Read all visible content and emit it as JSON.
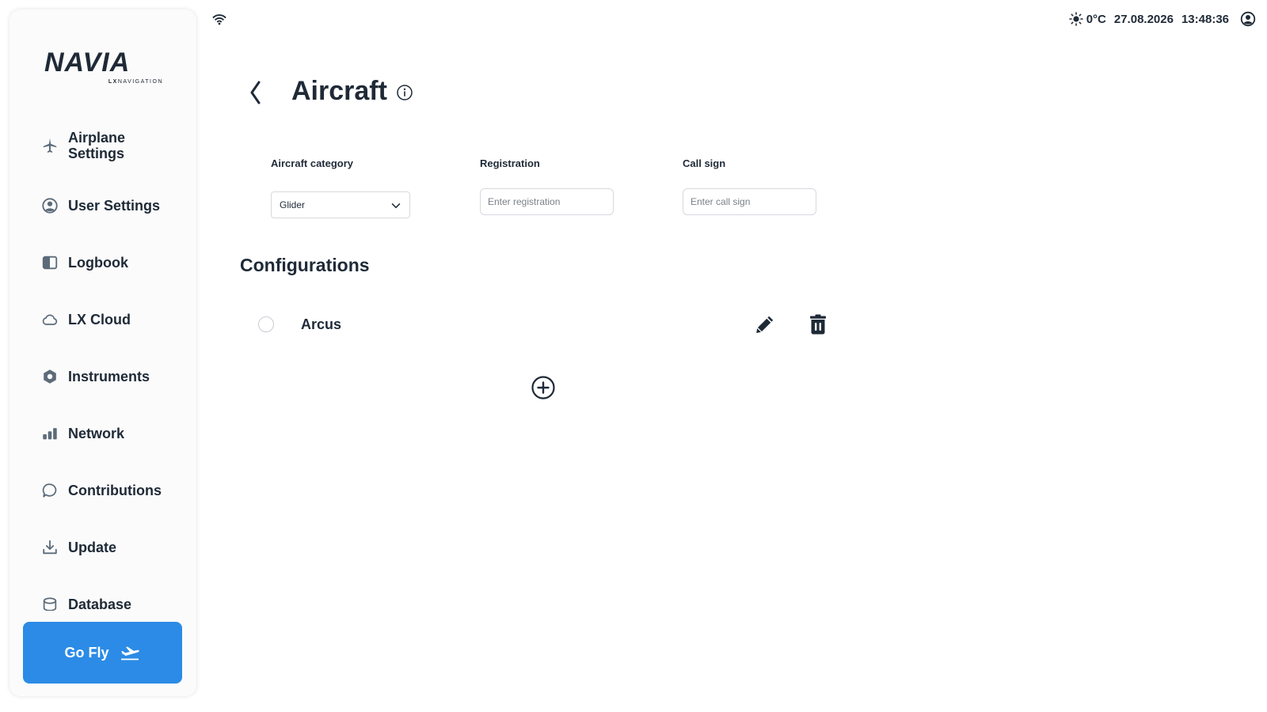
{
  "status_bar": {
    "temperature": "0°C",
    "date": "27.08.2026",
    "time": "13:48:36"
  },
  "sidebar": {
    "logo": {
      "brand": "NAVIA",
      "sub_bold": "LX",
      "sub_rest": "NAVIGATION"
    },
    "items": [
      {
        "label": "Airplane Settings",
        "icon": "airplane-icon"
      },
      {
        "label": "User Settings",
        "icon": "user-circle-icon"
      },
      {
        "label": "Logbook",
        "icon": "book-icon"
      },
      {
        "label": "LX Cloud",
        "icon": "cloud-icon"
      },
      {
        "label": "Instruments",
        "icon": "hexagon-icon"
      },
      {
        "label": "Network",
        "icon": "signal-bars-icon"
      },
      {
        "label": "Contributions",
        "icon": "chat-bubble-icon"
      },
      {
        "label": "Update",
        "icon": "download-icon"
      },
      {
        "label": "Database",
        "icon": "database-icon"
      }
    ],
    "go_fly_label": "Go Fly"
  },
  "header": {
    "title": "Aircraft"
  },
  "form": {
    "category_label": "Aircraft category",
    "category_value": "Glider",
    "registration_label": "Registration",
    "registration_placeholder": "Enter registration",
    "callsign_label": "Call sign",
    "callsign_placeholder": "Enter call sign"
  },
  "configurations": {
    "title": "Configurations",
    "items": [
      {
        "name": "Arcus",
        "selected": false
      }
    ]
  },
  "colors": {
    "accent": "#2b8be6",
    "text": "#1f2a37",
    "nav_icon": "#5c6b7a"
  }
}
